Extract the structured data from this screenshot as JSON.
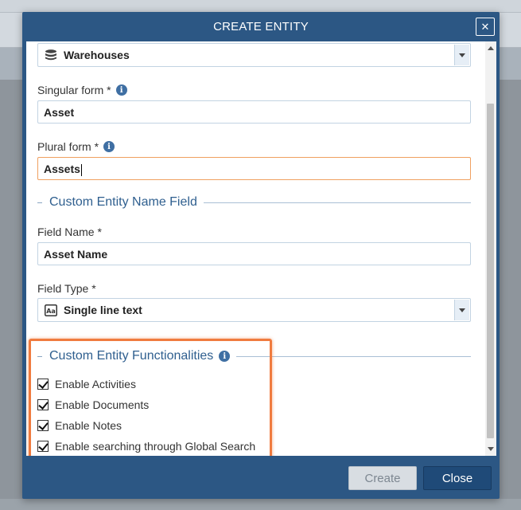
{
  "dialog": {
    "title": "CREATE ENTITY",
    "close_x": "✕"
  },
  "form": {
    "module_select": {
      "value": "Warehouses",
      "icon": "database-icon"
    },
    "singular": {
      "label": "Singular form *",
      "value": "Asset"
    },
    "plural": {
      "label": "Plural form *",
      "value": "Assets"
    },
    "name_section": {
      "title": "Custom Entity Name Field"
    },
    "field_name": {
      "label": "Field Name *",
      "value": "Asset Name"
    },
    "field_type": {
      "label": "Field Type *",
      "value": "Single line text",
      "icon": "text-field-icon"
    },
    "func_section": {
      "title": "Custom Entity Functionalities"
    },
    "functionalities": [
      {
        "label": "Enable Activities",
        "checked": true
      },
      {
        "label": "Enable Documents",
        "checked": true
      },
      {
        "label": "Enable Notes",
        "checked": true
      },
      {
        "label": "Enable searching through Global Search",
        "checked": true
      }
    ]
  },
  "footer": {
    "create_label": "Create",
    "close_label": "Close"
  },
  "colors": {
    "header_bg": "#2c5784",
    "highlight": "#f07b3f",
    "focus_border": "#f0a060"
  }
}
